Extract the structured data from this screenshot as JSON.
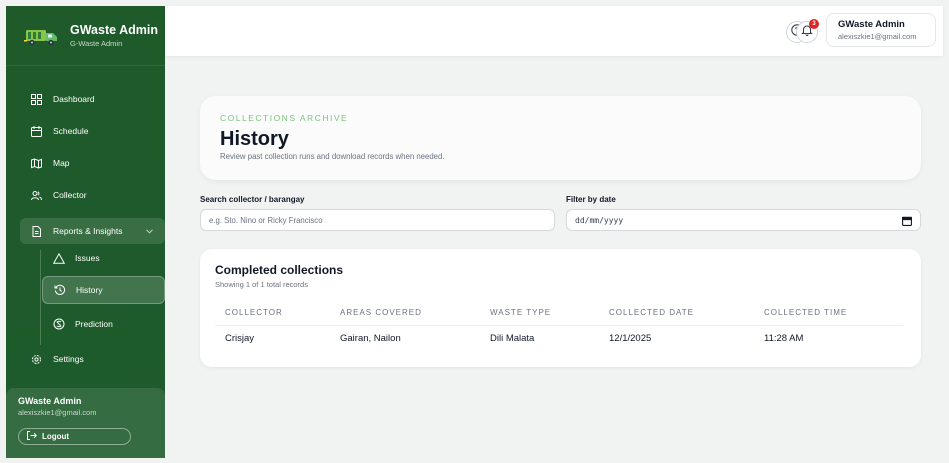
{
  "brand": {
    "title": "GWaste Admin",
    "subtitle": "G-Waste Admin"
  },
  "sidebar": {
    "items": [
      {
        "label": "Dashboard",
        "icon": "dashboard-grid-icon"
      },
      {
        "label": "Schedule",
        "icon": "calendar-icon"
      },
      {
        "label": "Map",
        "icon": "map-icon"
      },
      {
        "label": "Collector",
        "icon": "users-icon"
      },
      {
        "label": "Reports & Insights",
        "icon": "file-icon"
      },
      {
        "label": "Settings",
        "icon": "gear-icon"
      }
    ],
    "subitems": [
      {
        "label": "Issues",
        "icon": "warning-icon"
      },
      {
        "label": "History",
        "icon": "history-icon"
      },
      {
        "label": "Prediction",
        "icon": "prediction-icon"
      }
    ],
    "user": {
      "name": "GWaste Admin",
      "email": "alexiszkie1@gmail.com"
    },
    "logout_label": "Logout"
  },
  "topbar": {
    "notification_count": "3",
    "user": {
      "name": "GWaste Admin",
      "email": "alexiszkie1@gmail.com"
    }
  },
  "hero": {
    "eyebrow": "COLLECTIONS ARCHIVE",
    "title": "History",
    "description": "Review past collection runs and download records when needed."
  },
  "filters": {
    "search_label": "Search collector / barangay",
    "search_placeholder": "e.g. Sto. Nino or Ricky Francisco",
    "date_label": "Filter by date",
    "date_value": "dd/mm/yyyy"
  },
  "table": {
    "title": "Completed collections",
    "subtitle": "Showing 1 of 1 total records",
    "columns": [
      "COLLECTOR",
      "AREAS COVERED",
      "WASTE TYPE",
      "COLLECTED DATE",
      "COLLECTED TIME"
    ],
    "rows": [
      [
        "Crisjay",
        "Gairan, Nailon",
        "Dili Malata",
        "12/1/2025",
        "11:28 AM"
      ]
    ]
  },
  "colors": {
    "sidebar": "#1f5a2a",
    "accent": "#7ac47f",
    "badge": "#dc2626"
  }
}
